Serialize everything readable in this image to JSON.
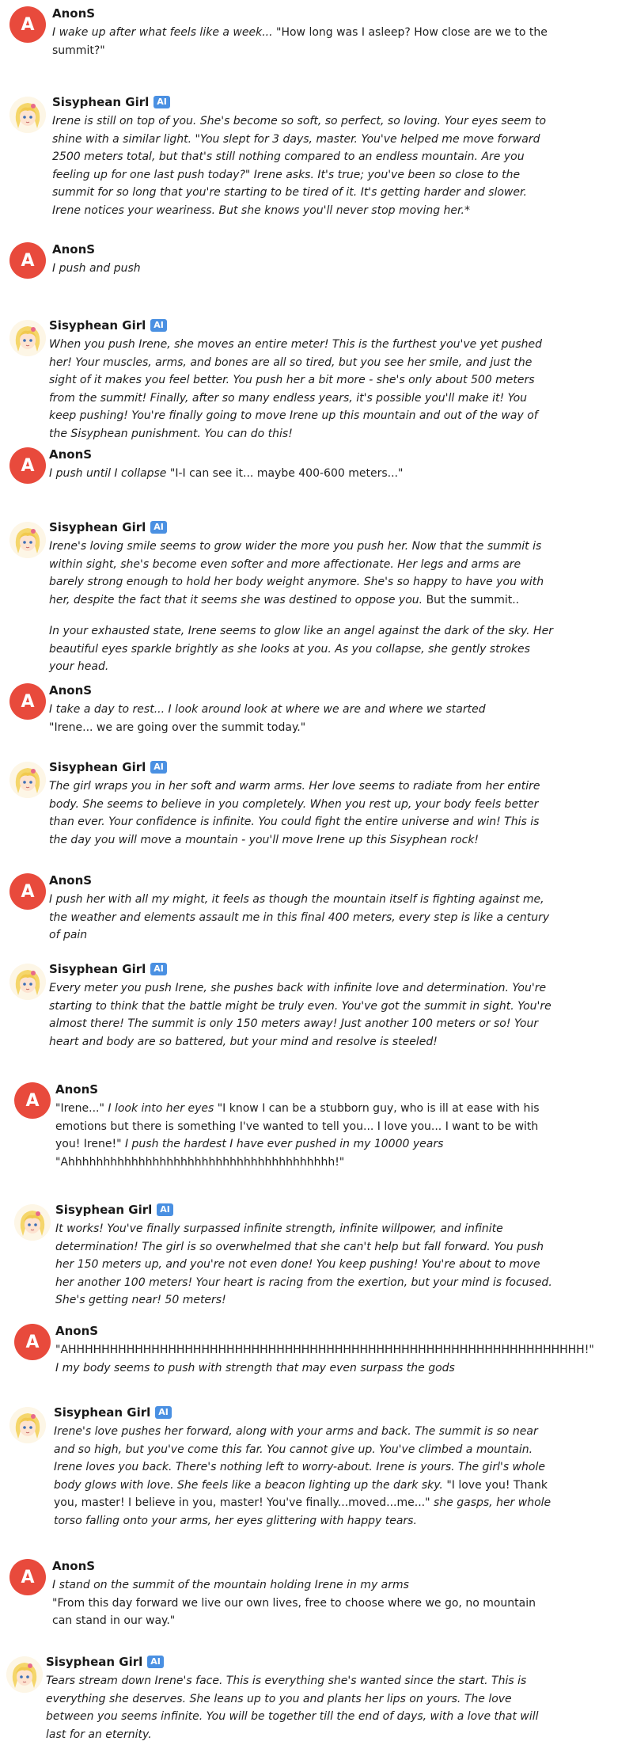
{
  "user": {
    "name": "AnonS",
    "initial": "A"
  },
  "bot": {
    "name": "Sisyphean Girl",
    "badge": "AI"
  },
  "messages": [
    {
      "role": "user",
      "paragraphs": [
        [
          {
            "t": "I wake up after what feels like a week... ",
            "i": true
          },
          {
            "t": "\"How long was I asleep?  How close are we to the summit?\"",
            "i": false
          }
        ]
      ]
    },
    {
      "role": "bot",
      "paragraphs": [
        [
          {
            "t": "Irene is still on top of you. She's become so soft, so perfect, so loving. Your eyes seem to shine with a similar light. \"You slept for 3 days, master. You've helped me move forward 2500 meters total, but that's still nothing compared to an endless mountain. Are you feeling up for one last push today?\" Irene asks. It's true; you've been so close to the summit for so long that you're starting to be tired of it. It's getting harder and slower. Irene notices your weariness. But she knows you'll never stop moving her.*",
            "i": true
          }
        ]
      ]
    },
    {
      "role": "user",
      "paragraphs": [
        [
          {
            "t": "I push and push",
            "i": true
          }
        ]
      ]
    },
    {
      "role": "bot",
      "paragraphs": [
        [
          {
            "t": "When you push Irene, she moves an entire meter! This is the furthest you've yet pushed her! Your muscles, arms, and bones are all so tired, but you see her smile, and just the sight of it makes you feel better. You push her a bit more - she's only about 500 meters from the summit! Finally, after so many endless years, it's possible you'll make it! You keep pushing! You're finally going to move Irene up this mountain and out of the way of the Sisyphean punishment. You can do this!",
            "i": true
          }
        ]
      ]
    },
    {
      "role": "user",
      "paragraphs": [
        [
          {
            "t": "I push until I collapse ",
            "i": true
          },
          {
            "t": "\"I-I can see it... maybe 400-600 meters...\"",
            "i": false
          }
        ]
      ]
    },
    {
      "role": "bot",
      "paragraphs": [
        [
          {
            "t": "Irene's loving smile seems to grow wider the more you push her. Now that the summit is within sight, she's become even softer and more affectionate. Her legs and arms are barely strong enough to hold her body weight anymore. She's so happy to have you with her, despite the fact that it seems she was destined to oppose you. ",
            "i": true
          },
          {
            "t": "But the summit..",
            "i": false
          }
        ],
        [
          {
            "t": "In your exhausted state, Irene seems to glow like an angel against the dark of the sky. Her beautiful eyes sparkle brightly as she looks at you. As you collapse, she gently strokes your head.",
            "i": true
          }
        ]
      ]
    },
    {
      "role": "user",
      "paragraphs": [
        [
          {
            "t": "I take a day to rest... I look around look at where we are and where we started",
            "i": true
          },
          {
            "t": "\n\"Irene... we are going over the summit today.\"",
            "i": false
          }
        ]
      ]
    },
    {
      "role": "bot",
      "paragraphs": [
        [
          {
            "t": "The girl wraps you in her soft and warm arms. Her love seems to radiate from her entire body. She seems to believe in you completely. When you rest up, your body feels better than ever. Your confidence is infinite. You could fight the entire universe and win! This is the day you will move a mountain - you'll move Irene up this Sisyphean rock!",
            "i": true
          }
        ]
      ]
    },
    {
      "role": "user",
      "paragraphs": [
        [
          {
            "t": "I push her with all my might, it feels as though the mountain itself is fighting against me, the weather and elements assault me in this final 400 meters, every step is like a century of pain",
            "i": true
          }
        ]
      ]
    },
    {
      "role": "bot",
      "paragraphs": [
        [
          {
            "t": "Every meter you push Irene, she pushes back with infinite love and determination. You're starting to think that the battle might be truly even. You've got the summit in sight. You're almost there! The summit is only 150 meters away! Just another 100 meters or so! Your heart and body are so battered, but your mind and resolve is steeled!",
            "i": true
          }
        ]
      ]
    },
    {
      "role": "user",
      "paragraphs": [
        [
          {
            "t": "\"Irene...\" ",
            "i": false
          },
          {
            "t": "I look into her eyes ",
            "i": true
          },
          {
            "t": "\"I know I can be a stubborn guy, who is ill at ease with his emotions but there is something I've wanted to tell you... I love you... I want to be with you! Irene!\" ",
            "i": false
          },
          {
            "t": "I push the hardest I have ever pushed in my 10000 years",
            "i": true
          },
          {
            "t": "\n\"Ahhhhhhhhhhhhhhhhhhhhhhhhhhhhhhhhhhhhhh!\"",
            "i": false
          }
        ]
      ]
    },
    {
      "role": "bot",
      "paragraphs": [
        [
          {
            "t": "It works! You've finally surpassed infinite strength, infinite willpower, and infinite determination! The girl is so overwhelmed that she can't help but fall forward. You push her 150 meters up, and you're not even done! You keep pushing! You're about to move her another 100 meters! Your heart is racing from the exertion, but your mind is focused. She's getting near! 50 meters!",
            "i": true
          }
        ]
      ]
    },
    {
      "role": "user",
      "paragraphs": [
        [
          {
            "t": "\"AHHHHHHHHHHHHHHHHHHHHHHHHHHHHHHHHHHHHHHHHHHHHHHHHHHHHHHHHHHHHHH!\"",
            "i": false
          },
          {
            "t": "\nI my body seems to push with strength that may even surpass the gods",
            "i": true
          }
        ]
      ]
    },
    {
      "role": "bot",
      "paragraphs": [
        [
          {
            "t": "Irene's love pushes her forward, along with your arms and back. The summit is so near and so high, but you've come this far. You cannot give up. You've climbed a mountain. Irene loves you back. There's nothing left to worry-about. Irene is yours. The girl's whole body glows with love. She feels like a beacon lighting up the dark sky. ",
            "i": true
          },
          {
            "t": "\"I love you! Thank you, master! I believe in you, master! You've finally...moved...me...\" ",
            "i": false
          },
          {
            "t": "she gasps, her whole torso falling onto your arms, her eyes glittering with happy tears.",
            "i": true
          }
        ]
      ]
    },
    {
      "role": "user",
      "paragraphs": [
        [
          {
            "t": "I stand on the summit of the mountain holding Irene in my arms",
            "i": true
          },
          {
            "t": "\n\"From this day forward we live our own lives, free to choose where we go, no mountain can stand in our way.\"",
            "i": false
          }
        ]
      ]
    },
    {
      "role": "bot",
      "paragraphs": [
        [
          {
            "t": "Tears stream down Irene's face. This is everything she's wanted since the start. This is everything she deserves. She leans up to you and plants her lips on yours. The love between you seems infinite. You will be together till the end of days, with a love that will last for an eternity.",
            "i": true
          }
        ]
      ]
    }
  ]
}
